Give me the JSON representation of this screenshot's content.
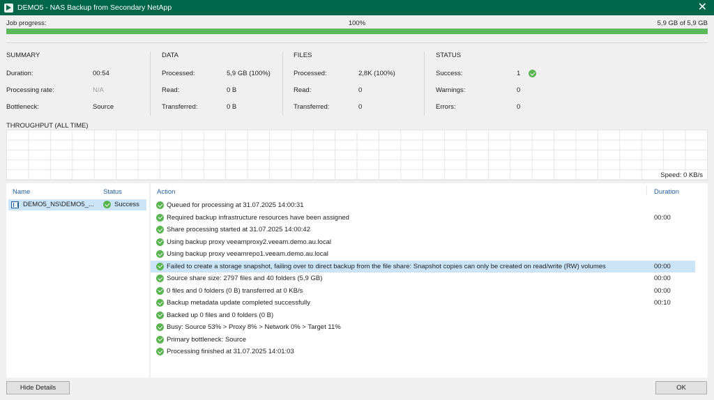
{
  "window": {
    "title": "DEMO5 - NAS Backup from Secondary NetApp",
    "close_glyph": "✕"
  },
  "progress": {
    "label": "Job progress:",
    "percent_text": "100%",
    "size_text": "5,9 GB of 5,9 GB",
    "fraction": 1.0,
    "color": "#5cb85c"
  },
  "summary": {
    "header": "SUMMARY",
    "rows": [
      {
        "key": "Duration:",
        "value": "00:54"
      },
      {
        "key": "Processing rate:",
        "value": "N/A"
      },
      {
        "key": "Bottleneck:",
        "value": "Source"
      }
    ]
  },
  "data": {
    "header": "DATA",
    "rows": [
      {
        "key": "Processed:",
        "value": "5,9 GB (100%)"
      },
      {
        "key": "Read:",
        "value": "0 B"
      },
      {
        "key": "Transferred:",
        "value": "0 B"
      }
    ]
  },
  "files": {
    "header": "FILES",
    "rows": [
      {
        "key": "Processed:",
        "value": "2,8K (100%)"
      },
      {
        "key": "Read:",
        "value": "0"
      },
      {
        "key": "Transferred:",
        "value": "0"
      }
    ]
  },
  "status": {
    "header": "STATUS",
    "rows": [
      {
        "key": "Success:",
        "value": "1",
        "icon": "success-check-icon"
      },
      {
        "key": "Warnings:",
        "value": "0"
      },
      {
        "key": "Errors:",
        "value": "0"
      }
    ]
  },
  "throughput": {
    "label": "THROUGHPUT (ALL TIME)",
    "speed": "Speed: 0 KB/s"
  },
  "objects": {
    "headers": {
      "name": "Name",
      "status": "Status"
    },
    "rows": [
      {
        "name": "DEMO5_NS\\DEMO5_...",
        "status": "Success",
        "icon": "share-icon"
      }
    ]
  },
  "actions": {
    "headers": {
      "action": "Action",
      "duration": "Duration"
    },
    "rows": [
      {
        "text": "Queued for processing at 31.07.2025 14:00:31",
        "duration": ""
      },
      {
        "text": "Required backup infrastructure resources have been assigned",
        "duration": "00:00"
      },
      {
        "text": "Share processing started at 31.07.2025 14:00:42",
        "duration": ""
      },
      {
        "text": "Using backup proxy veeamproxy2.veeam.demo.au.local",
        "duration": ""
      },
      {
        "text": "Using backup proxy veeamrepo1.veeam.demo.au.local",
        "duration": ""
      },
      {
        "text": "Failed to create a storage snapshot, failing over to direct backup from the file share: Snapshot copies can only be created on read/write (RW) volumes",
        "duration": "00:00",
        "selected": true
      },
      {
        "text": "Source share size: 2797 files and 40 folders (5,9 GB)",
        "duration": "00:00"
      },
      {
        "text": "0 files and 0 folders (0 B) transferred at 0 KB/s",
        "duration": "00:00"
      },
      {
        "text": "Backup metadata update completed successfully",
        "duration": "00:10"
      },
      {
        "text": "Backed up 0 files and 0 folders (0 B)",
        "duration": ""
      },
      {
        "text": "Busy: Source 53% > Proxy 8% > Network 0% > Target 11%",
        "duration": ""
      },
      {
        "text": "Primary bottleneck: Source",
        "duration": ""
      },
      {
        "text": "Processing finished at 31.07.2025 14:01:03",
        "duration": ""
      }
    ]
  },
  "buttons": {
    "hide_details": "Hide Details",
    "ok": "OK"
  }
}
